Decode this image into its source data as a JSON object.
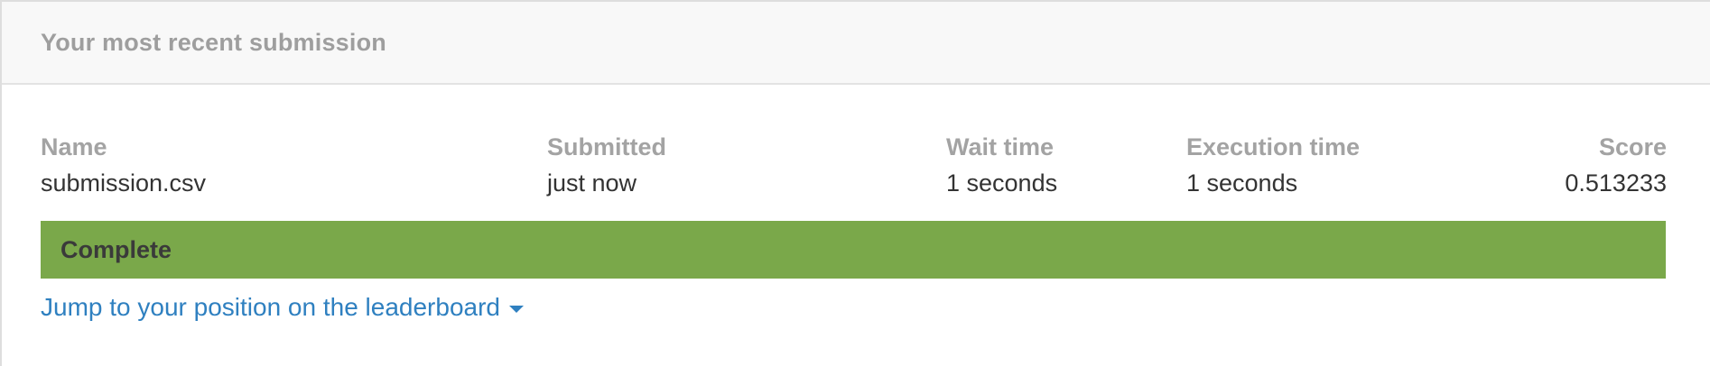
{
  "header": {
    "title": "Your most recent submission"
  },
  "submission": {
    "columns": {
      "name": "Name",
      "submitted": "Submitted",
      "wait_time": "Wait time",
      "execution_time": "Execution time",
      "score": "Score"
    },
    "row": {
      "name": "submission.csv",
      "submitted": "just now",
      "wait_time": "1 seconds",
      "execution_time": "1 seconds",
      "score": "0.513233"
    }
  },
  "status": {
    "label": "Complete",
    "color": "#7aa84a"
  },
  "leaderboard_link": {
    "label": "Jump to your position on the leaderboard",
    "icon": "caret-down-icon",
    "color": "#2f80c0"
  }
}
